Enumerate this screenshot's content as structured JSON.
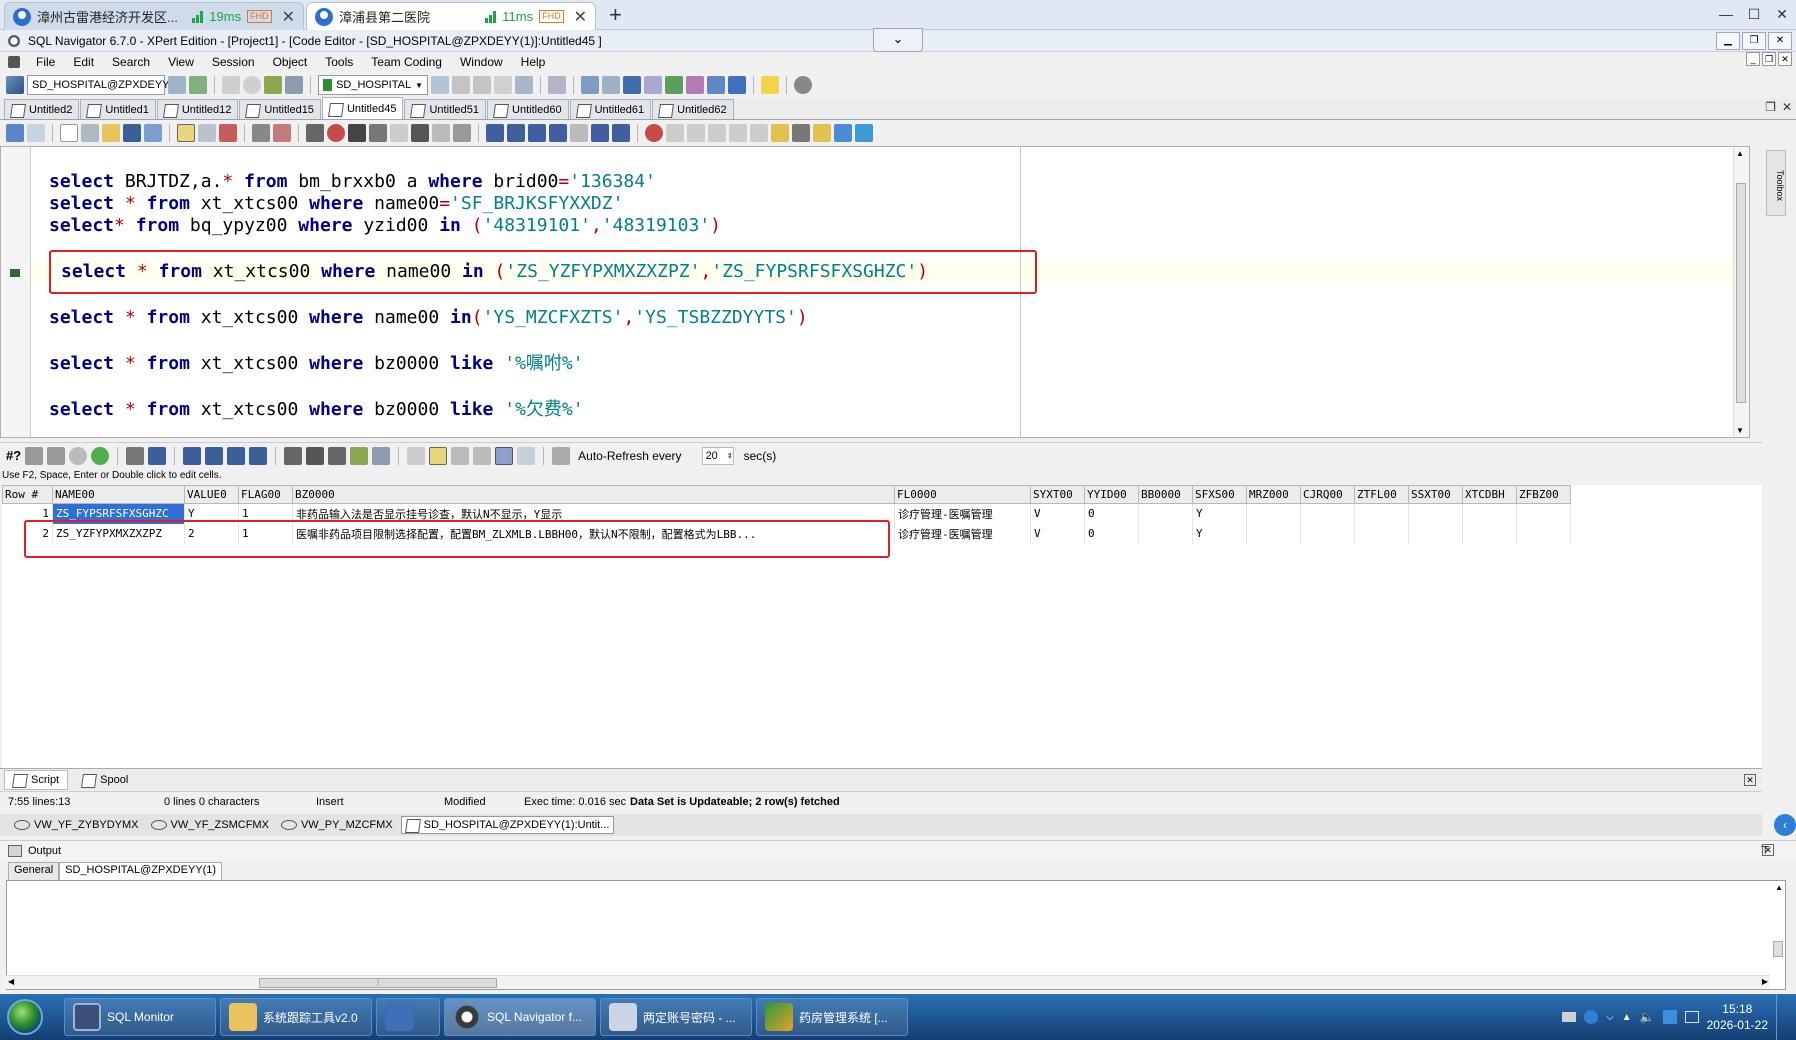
{
  "browser_tabs": [
    {
      "title": "漳州古雷港经济开发区...",
      "latency": "19ms",
      "badge": "FHD",
      "active": false
    },
    {
      "title": "漳浦县第二医院",
      "latency": "11ms",
      "badge": "FHD",
      "active": true
    }
  ],
  "app": {
    "title": "SQL Navigator 6.7.0 - XPert Edition - [Project1] - [Code Editor - [SD_HOSPITAL@ZPXDEYY(1)]:Untitled45 ]"
  },
  "menu": [
    "File",
    "Edit",
    "Search",
    "View",
    "Session",
    "Object",
    "Tools",
    "Team Coding",
    "Window",
    "Help"
  ],
  "toolbar": {
    "connection": "SD_HOSPITAL@ZPXDEYY",
    "schema": "SD_HOSPITAL"
  },
  "doc_tabs": [
    "Untitled2",
    "Untitled1",
    "Untitled12",
    "Untitled15",
    "Untitled45",
    "Untitled51",
    "Untitled60",
    "Untitled61",
    "Untitled62"
  ],
  "doc_tab_selected": "Untitled45",
  "editor": {
    "lines": [
      [
        {
          "t": "select",
          "c": "kw"
        },
        {
          "t": " BRJTDZ,a.",
          "c": ""
        },
        {
          "t": "*",
          "c": "op"
        },
        {
          "t": " ",
          "c": ""
        },
        {
          "t": "from",
          "c": "kw"
        },
        {
          "t": " bm_brxxb0 a ",
          "c": ""
        },
        {
          "t": "where",
          "c": "kw"
        },
        {
          "t": " brid00",
          "c": ""
        },
        {
          "t": "=",
          "c": "op"
        },
        {
          "t": "'136384'",
          "c": "st"
        }
      ],
      [
        {
          "t": "select",
          "c": "kw"
        },
        {
          "t": " ",
          "c": ""
        },
        {
          "t": "*",
          "c": "op"
        },
        {
          "t": " ",
          "c": ""
        },
        {
          "t": "from",
          "c": "kw"
        },
        {
          "t": " xt_xtcs00 ",
          "c": ""
        },
        {
          "t": "where",
          "c": "kw"
        },
        {
          "t": " name00",
          "c": ""
        },
        {
          "t": "=",
          "c": "op"
        },
        {
          "t": "'SF_BRJKSFYXXDZ'",
          "c": "st"
        }
      ],
      [
        {
          "t": "select",
          "c": "kw"
        },
        {
          "t": "*",
          "c": "op"
        },
        {
          "t": " ",
          "c": ""
        },
        {
          "t": "from",
          "c": "kw"
        },
        {
          "t": " bq_ypyz00 ",
          "c": ""
        },
        {
          "t": "where",
          "c": "kw"
        },
        {
          "t": " yzid00 ",
          "c": ""
        },
        {
          "t": "in",
          "c": "kw"
        },
        {
          "t": " (",
          "c": "op"
        },
        {
          "t": "'48319101'",
          "c": "st"
        },
        {
          "t": ",",
          "c": "op"
        },
        {
          "t": "'48319103'",
          "c": "st"
        },
        {
          "t": ")",
          "c": "op"
        }
      ],
      [
        {
          "t": "select",
          "c": "kw"
        },
        {
          "t": " ",
          "c": ""
        },
        {
          "t": "*",
          "c": "op"
        },
        {
          "t": " ",
          "c": ""
        },
        {
          "t": "from",
          "c": "kw"
        },
        {
          "t": " xt_xtcs00 ",
          "c": ""
        },
        {
          "t": "where",
          "c": "kw"
        },
        {
          "t": " name00 ",
          "c": ""
        },
        {
          "t": "in",
          "c": "kw"
        },
        {
          "t": " (",
          "c": "op"
        },
        {
          "t": "'ZS_YZFYPXMXZXZPZ'",
          "c": "st"
        },
        {
          "t": ",",
          "c": "op"
        },
        {
          "t": "'ZS_FYPSRFSFXSGHZC'",
          "c": "st"
        },
        {
          "t": ")",
          "c": "op"
        }
      ],
      [
        {
          "t": "select",
          "c": "kw"
        },
        {
          "t": " ",
          "c": ""
        },
        {
          "t": "*",
          "c": "op"
        },
        {
          "t": " ",
          "c": ""
        },
        {
          "t": "from",
          "c": "kw"
        },
        {
          "t": " xt_xtcs00 ",
          "c": ""
        },
        {
          "t": "where",
          "c": "kw"
        },
        {
          "t": " name00 ",
          "c": ""
        },
        {
          "t": "in",
          "c": "kw"
        },
        {
          "t": "(",
          "c": "op"
        },
        {
          "t": "'YS_MZCFXZTS'",
          "c": "st"
        },
        {
          "t": ",",
          "c": "op"
        },
        {
          "t": "'YS_TSBZZDYYTS'",
          "c": "st"
        },
        {
          "t": ")",
          "c": "op"
        }
      ],
      [
        {
          "t": "select",
          "c": "kw"
        },
        {
          "t": " ",
          "c": ""
        },
        {
          "t": "*",
          "c": "op"
        },
        {
          "t": " ",
          "c": ""
        },
        {
          "t": "from",
          "c": "kw"
        },
        {
          "t": " xt_xtcs00 ",
          "c": ""
        },
        {
          "t": "where",
          "c": "kw"
        },
        {
          "t": " bz0000 ",
          "c": ""
        },
        {
          "t": "like",
          "c": "kw"
        },
        {
          "t": " ",
          "c": ""
        },
        {
          "t": "'%嘱咐%'",
          "c": "st"
        }
      ],
      [
        {
          "t": "select",
          "c": "kw"
        },
        {
          "t": " ",
          "c": ""
        },
        {
          "t": "*",
          "c": "op"
        },
        {
          "t": " ",
          "c": ""
        },
        {
          "t": "from",
          "c": "kw"
        },
        {
          "t": " xt_xtcs00 ",
          "c": ""
        },
        {
          "t": "where",
          "c": "kw"
        },
        {
          "t": " bz0000 ",
          "c": ""
        },
        {
          "t": "like",
          "c": "kw"
        },
        {
          "t": " ",
          "c": ""
        },
        {
          "t": "'%欠费%'",
          "c": "st"
        }
      ]
    ]
  },
  "results_toolbar": {
    "label_hash": "#?",
    "auto_refresh_label": "Auto-Refresh every",
    "auto_refresh_value": "20",
    "auto_refresh_unit": "sec(s)"
  },
  "hint": "Use F2, Space, Enter or Double click to edit cells.",
  "grid": {
    "columns": [
      "Row #",
      "NAME00",
      "VALUE0",
      "FLAG00",
      "BZ0000",
      "FL0000",
      "SYXT00",
      "YYID00",
      "BB0000",
      "SFXS00",
      "MRZ000",
      "CJRQ00",
      "ZTFL00",
      "SSXT00",
      "XTCDBH",
      "ZFBZ00"
    ],
    "rows": [
      [
        "1",
        "ZS_FYPSRFSFXSGHZC",
        "Y",
        "1",
        "非药品输入法是否显示挂号诊查，默认N不显示，Y显示",
        "诊疗管理-医嘱管理",
        "V",
        "0",
        "",
        "Y",
        "",
        "",
        "",
        "",
        "",
        ""
      ],
      [
        "2",
        "ZS_YZFYPXMXZXZPZ",
        "2",
        "1",
        "医嘱非药品项目限制选择配置，配置BM_ZLXMLB.LBBH00，默认N不限制，配置格式为LBB...",
        "诊疗管理-医嘱管理",
        "V",
        "0",
        "",
        "Y",
        "",
        "",
        "",
        "",
        "",
        ""
      ]
    ]
  },
  "bottom_tabs": [
    "Script",
    "Spool"
  ],
  "status": {
    "position": "7:55 lines:13",
    "selection": "0 lines 0 characters",
    "mode": "Insert",
    "modified": "Modified",
    "exec_time": "Exec time: 0.016 sec",
    "dataset": "Data Set is Updateable; 2 row(s) fetched"
  },
  "window_tabs": [
    "VW_YF_ZYBYDYMX",
    "VW_YF_ZSMCFMX",
    "VW_PY_MZCFMX",
    "SD_HOSPITAL@ZPXDEYY(1):Untit..."
  ],
  "output": {
    "title": "Output",
    "tabs": [
      "General",
      "SD_HOSPITAL@ZPXDEYY(1)"
    ]
  },
  "taskbar": {
    "items": [
      "SQL Monitor",
      "系统跟踪工具v2.0",
      "",
      "SQL Navigator f...",
      "两定账号密码 - ...",
      "药房管理系统 [..."
    ],
    "time": "15:18",
    "date": "2026-01-22"
  },
  "colors": {
    "keyword": "#00008b",
    "string": "#00808b",
    "highlight_box": "#e02020",
    "selected_cell": "#2f6fd8"
  }
}
